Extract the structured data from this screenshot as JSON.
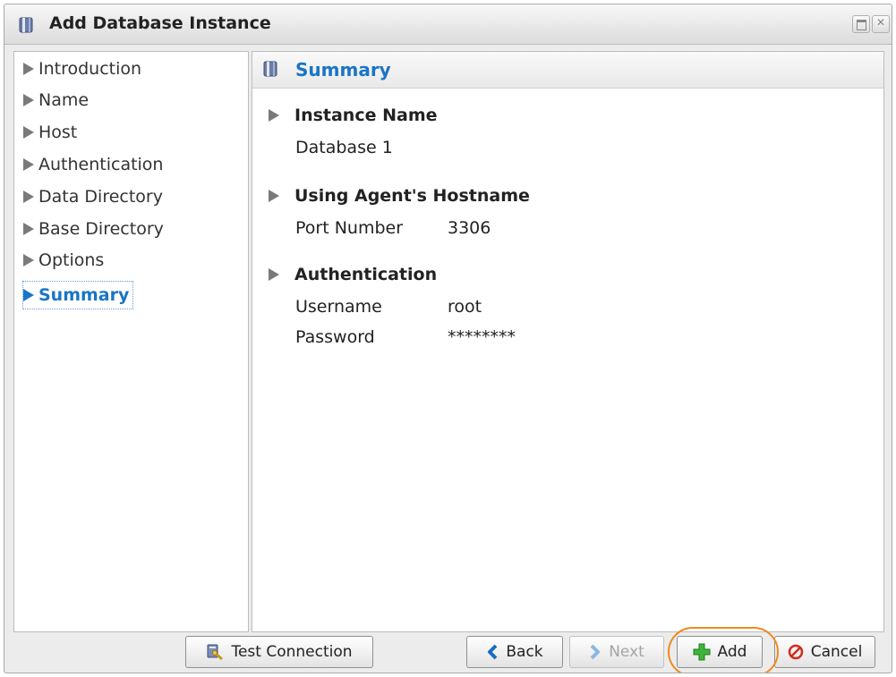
{
  "window": {
    "title": "Add Database Instance"
  },
  "sidebar": {
    "items": [
      {
        "label": "Introduction"
      },
      {
        "label": "Name"
      },
      {
        "label": "Host"
      },
      {
        "label": "Authentication"
      },
      {
        "label": "Data Directory"
      },
      {
        "label": "Base Directory"
      },
      {
        "label": "Options"
      },
      {
        "label": "Summary",
        "active": true
      }
    ]
  },
  "summary": {
    "header": "Summary",
    "instance": {
      "title": "Instance Name",
      "value": "Database 1"
    },
    "host": {
      "title": "Using Agent's Hostname",
      "port_label": "Port Number",
      "port_value": "3306"
    },
    "auth": {
      "title": "Authentication",
      "username_label": "Username",
      "username_value": "root",
      "password_label": "Password",
      "password_value": "********"
    }
  },
  "buttons": {
    "test_connection": "Test Connection",
    "back": "Back",
    "next": "Next",
    "add": "Add",
    "cancel": "Cancel"
  },
  "colors": {
    "accent": "#1a75c6",
    "highlight": "#f08a1c",
    "add_icon": "#3fb43a",
    "cancel_icon": "#d32a1c"
  },
  "icons": {
    "title": "database-icon",
    "header": "database-icon",
    "test_connection": "test-connection-icon",
    "back": "chevron-left-icon",
    "next": "chevron-right-icon",
    "add": "plus-icon",
    "cancel": "cancel-icon"
  }
}
